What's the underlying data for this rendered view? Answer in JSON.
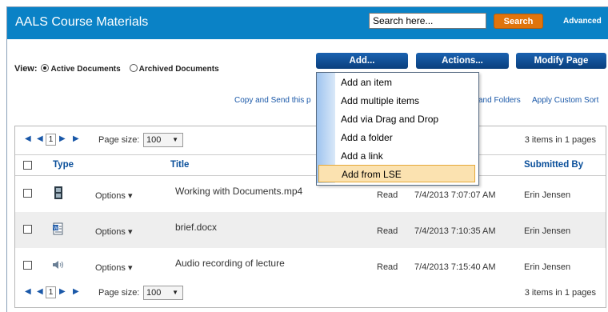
{
  "header": {
    "title": "AALS Course Materials",
    "search_value": "Search here...",
    "search_label": "Search",
    "advanced_label": "Advanced"
  },
  "view": {
    "label": "View:",
    "active": "Active Documents",
    "archived": "Archived Documents"
  },
  "toolbar": {
    "add": "Add...",
    "actions": "Actions...",
    "modify": "Modify Page"
  },
  "links": {
    "copy_send": "Copy and Send this p",
    "and_folders": "and Folders",
    "apply_sort": "Apply Custom Sort"
  },
  "menu": {
    "items": [
      "Add an item",
      "Add multiple items",
      "Add via Drag and Drop",
      "Add a folder",
      "Add a link",
      "Add from LSE"
    ]
  },
  "pager": {
    "page": "1",
    "size_label": "Page size:",
    "size": "100",
    "info": "3 items in 1 pages"
  },
  "columns": {
    "type": "Type",
    "title": "Title",
    "submitted_by": "Submitted By"
  },
  "rows": [
    {
      "options": "Options",
      "title": "Working with Documents.mp4",
      "status": "Read",
      "date": "7/4/2013 7:07:07 AM",
      "author": "Erin Jensen",
      "icon": "video-file-icon"
    },
    {
      "options": "Options",
      "title": "brief.docx",
      "status": "Read",
      "date": "7/4/2013 7:10:35 AM",
      "author": "Erin Jensen",
      "icon": "word-document-icon"
    },
    {
      "options": "Options",
      "title": "Audio recording of lecture",
      "status": "Read",
      "date": "7/4/2013 7:15:40 AM",
      "author": "Erin Jensen",
      "icon": "audio-file-icon"
    }
  ],
  "colors": {
    "topbar": "#0a82c6",
    "search_button": "#e0740c",
    "nav_button": "#0b4a8e",
    "menu_highlight": "#fbe2b0"
  }
}
